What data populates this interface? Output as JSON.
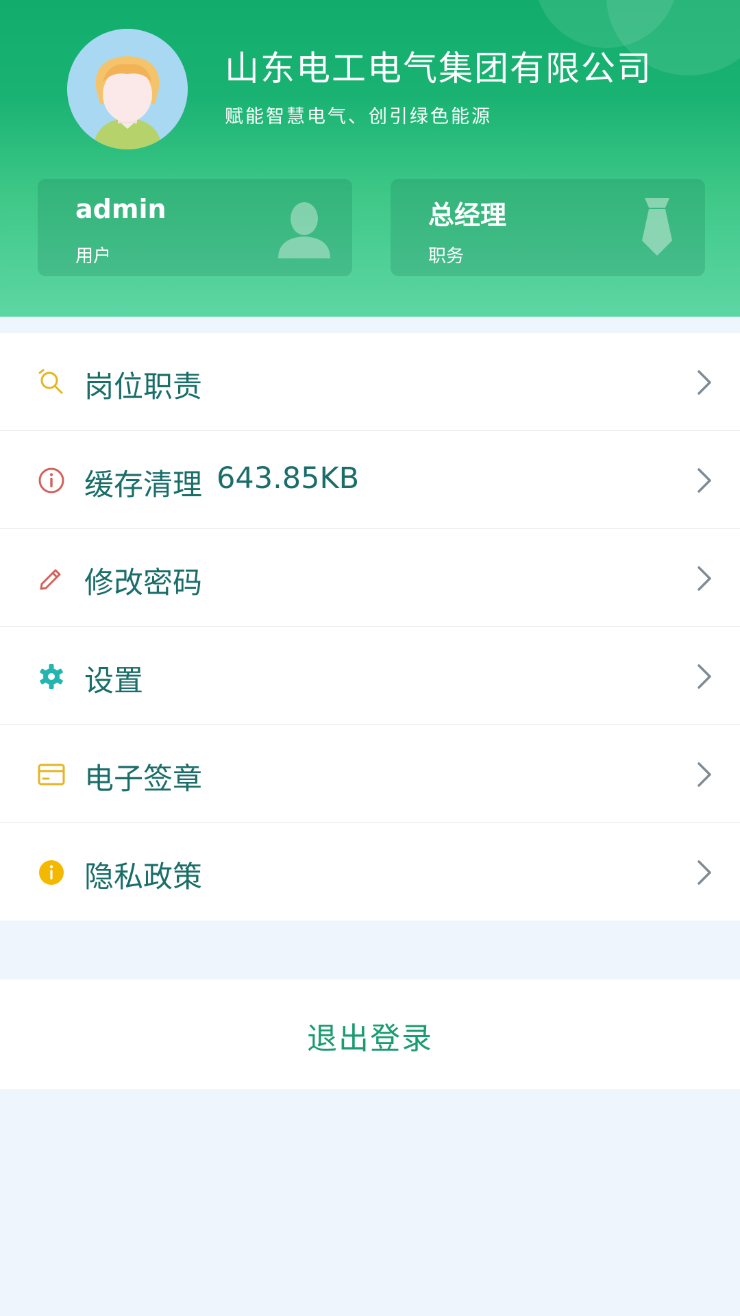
{
  "profile": {
    "company_name": "山东电工电气集团有限公司",
    "slogan": "赋能智慧电气、创引绿色能源",
    "avatar_icon": "avatar-icon"
  },
  "cards": {
    "user": {
      "value": "admin",
      "label": "用户",
      "icon": "person-icon"
    },
    "role": {
      "value": "总经理",
      "label": "职务",
      "icon": "tie-icon"
    }
  },
  "menu": {
    "items": [
      {
        "label": "岗位职责",
        "icon": "responsibility-icon",
        "icon_color": "#e6b422"
      },
      {
        "label": "缓存清理",
        "value": "643.85KB",
        "icon": "info-circle-icon",
        "icon_color": "#d0625a"
      },
      {
        "label": "修改密码",
        "icon": "pencil-icon",
        "icon_color": "#d0625a"
      },
      {
        "label": "设置",
        "icon": "gear-icon",
        "icon_color": "#23b5b0"
      },
      {
        "label": "电子签章",
        "icon": "card-icon",
        "icon_color": "#e6b422"
      },
      {
        "label": "隐私政策",
        "icon": "info-filled-icon",
        "icon_color": "#f5b800"
      }
    ]
  },
  "logout": {
    "label": "退出登录"
  },
  "colors": {
    "header_top": "#12ad6d",
    "header_bottom": "#5dd6a3",
    "menu_text": "#1a6e6a",
    "logout_text": "#1a9b70",
    "page_background": "#eef5fd"
  }
}
